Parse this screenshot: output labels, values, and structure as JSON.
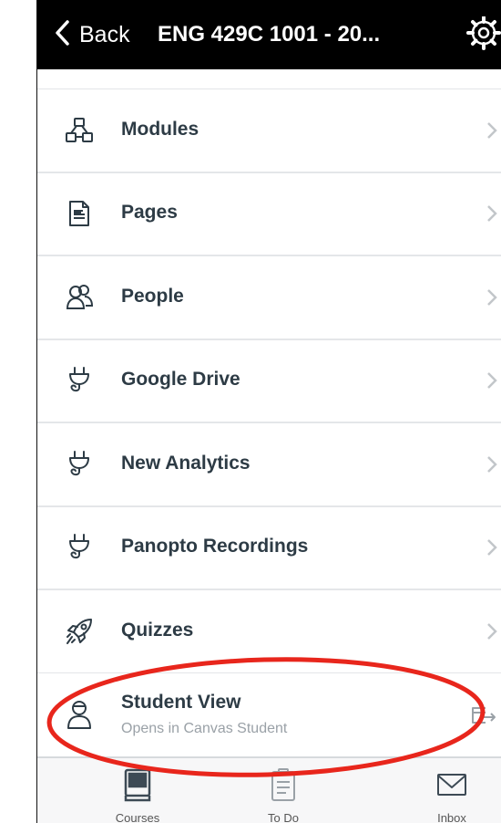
{
  "navbar": {
    "back_label": "Back",
    "title": "ENG 429C 1001 - 20...",
    "settings_icon": "gear-icon"
  },
  "menu": {
    "items": [
      {
        "label": "Modules",
        "icon": "modules-icon"
      },
      {
        "label": "Pages",
        "icon": "page-document-icon"
      },
      {
        "label": "People",
        "icon": "people-icon"
      },
      {
        "label": "Google Drive",
        "icon": "plug-icon"
      },
      {
        "label": "New Analytics",
        "icon": "plug-icon"
      },
      {
        "label": "Panopto Recordings",
        "icon": "plug-icon"
      },
      {
        "label": "Quizzes",
        "icon": "rocket-icon"
      }
    ],
    "student_view": {
      "title": "Student View",
      "subtitle": "Opens in Canvas Student",
      "icon": "student-icon",
      "action_icon": "external-link-icon"
    }
  },
  "tabbar": {
    "tabs": [
      {
        "label": "Courses",
        "icon": "courses-icon"
      },
      {
        "label": "To Do",
        "icon": "clipboard-icon"
      },
      {
        "label": "Inbox",
        "icon": "mail-icon"
      }
    ]
  },
  "colors": {
    "navbar_bg": "#000000",
    "text": "#2d3b45",
    "subtext": "#9aa1a7",
    "annotation": "#e8261c"
  }
}
